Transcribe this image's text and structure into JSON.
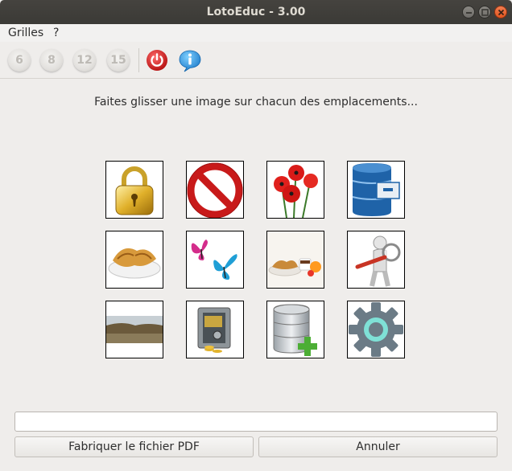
{
  "window": {
    "title": "LotoEduc - 3.00"
  },
  "menu": {
    "items": [
      "Grilles",
      "?"
    ]
  },
  "toolbar": {
    "grid_buttons": [
      "6",
      "8",
      "12",
      "15"
    ],
    "power_icon": "power-icon",
    "info_icon": "info-icon"
  },
  "main": {
    "instruction": "Faites glisser une image sur chacun des emplacements...",
    "images": [
      "padlock-image",
      "forbidden-sign-image",
      "poppies-image",
      "database-drawer-image",
      "croissants-image",
      "butterflies-image",
      "breakfast-image",
      "magnifier-person-image",
      "landscape-photo-image",
      "safe-money-image",
      "database-add-image",
      "settings-gear-image"
    ]
  },
  "footer": {
    "filename_value": "",
    "make_pdf_label": "Fabriquer le fichier PDF",
    "cancel_label": "Annuler"
  }
}
